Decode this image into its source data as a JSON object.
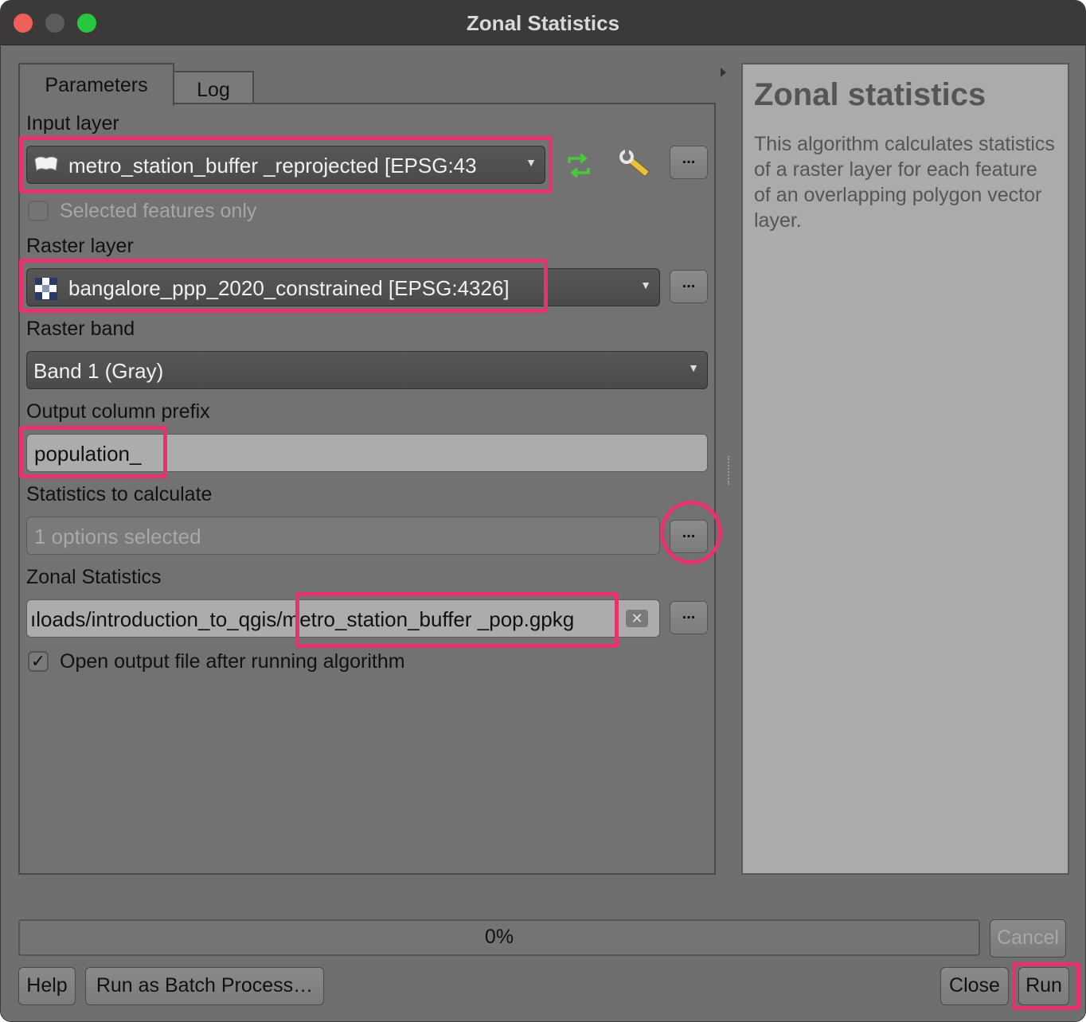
{
  "window": {
    "title": "Zonal Statistics"
  },
  "tabs": [
    {
      "label": "Parameters"
    },
    {
      "label": "Log"
    }
  ],
  "params": {
    "input_layer": {
      "label": "Input layer",
      "value": "metro_station_buffer _reprojected [EPSG:43",
      "selected_only_label": "Selected features only",
      "selected_only_checked": false
    },
    "raster_layer": {
      "label": "Raster layer",
      "value": "bangalore_ppp_2020_constrained [EPSG:4326]"
    },
    "raster_band": {
      "label": "Raster band",
      "value": "Band 1 (Gray)"
    },
    "output_prefix": {
      "label": "Output column prefix",
      "value": "population_"
    },
    "statistics": {
      "label": "Statistics to calculate",
      "value": "1 options selected"
    },
    "zonal_output": {
      "label": "Zonal Statistics",
      "value_dir": "ıloads/introduction_to_qgis",
      "value_file": "/metro_station_buffer _pop.gpkg",
      "open_after_label": "Open output file after running algorithm",
      "open_after_checked": true
    },
    "ellipsis": "..."
  },
  "help": {
    "title": "Zonal statistics",
    "body": "This algorithm calculates statistics of a raster layer for each feature of an overlapping polygon vector layer."
  },
  "progress": {
    "value": 0,
    "text": "0%"
  },
  "buttons": {
    "cancel": "Cancel",
    "help": "Help",
    "batch": "Run as Batch Process…",
    "close": "Close",
    "run": "Run"
  },
  "colors": {
    "highlight": "#e6336c",
    "refresh_icon": "#46c93a"
  }
}
